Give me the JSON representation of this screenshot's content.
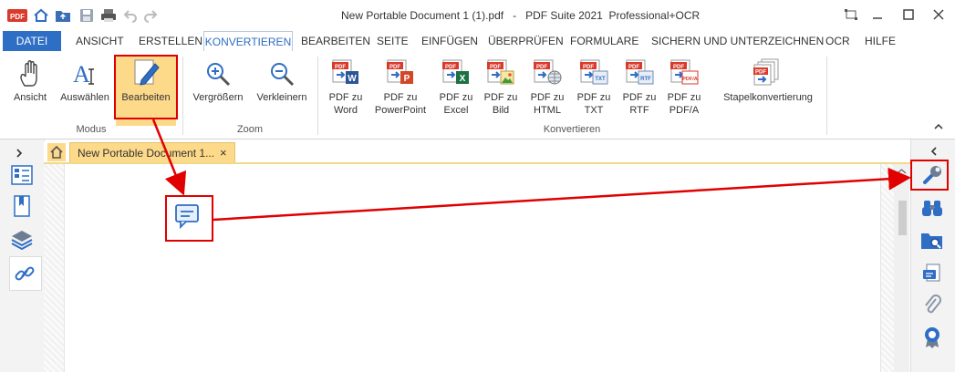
{
  "window": {
    "title": "New Portable Document 1 (1).pdf   -   PDF Suite 2021  Professional+OCR"
  },
  "menu": {
    "items": [
      "DATEI",
      "ANSICHT",
      "ERSTELLEN",
      "KONVERTIEREN",
      "BEARBEITEN",
      "SEITE",
      "EINFÜGEN",
      "ÜBERPRÜFEN",
      "FORMULARE",
      "SICHERN UND UNTERZEICHNEN",
      "OCR",
      "HILFE"
    ],
    "active": "KONVERTIEREN"
  },
  "ribbon": {
    "modus": {
      "label": "Modus",
      "ansicht": "Ansicht",
      "auswaehlen": "Auswählen",
      "bearbeiten": "Bearbeiten"
    },
    "zoom": {
      "label": "Zoom",
      "vergroessern": "Vergrößern",
      "verkleinern": "Verkleinern"
    },
    "konvertieren": {
      "label": "Konvertieren",
      "word": [
        "PDF zu",
        "Word"
      ],
      "powerpoint": [
        "PDF zu",
        "PowerPoint"
      ],
      "excel": [
        "PDF zu",
        "Excel"
      ],
      "bild": [
        "PDF zu",
        "Bild"
      ],
      "html": [
        "PDF zu",
        "HTML"
      ],
      "txt": [
        "PDF zu",
        "TXT"
      ],
      "rtf": [
        "PDF zu",
        "RTF"
      ],
      "pdfa": [
        "PDF zu",
        "PDF/A"
      ],
      "stapel": "Stapelkonvertierung"
    }
  },
  "document_tab": {
    "label": "New Portable Document 1...",
    "close": "×"
  },
  "colors": {
    "accent": "#2e6ec4",
    "highlight": "#fdd98a",
    "annotation_red": "#e00000",
    "pdf_red": "#d93a2b"
  },
  "icons": {
    "pdf_badge": "PDF",
    "word_letter": "W",
    "ppt_letter": "P",
    "excel_letter": "X",
    "txt_badge": "TXT",
    "rtf_badge": "RTF",
    "pdfa_badge": "PDF/A"
  }
}
